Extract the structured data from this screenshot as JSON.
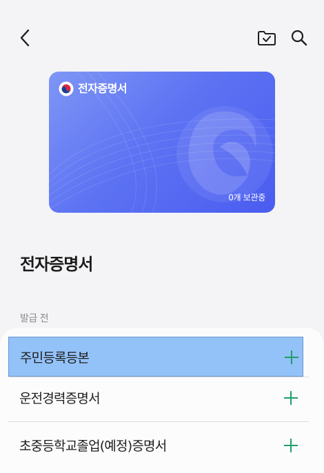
{
  "header": {
    "back_icon": "chevron-left-icon",
    "folder_icon": "folder-check-icon",
    "search_icon": "search-icon"
  },
  "card": {
    "title": "전자증명서",
    "count": "0개 보관중",
    "emblem_icon": "taegeuk-emblem-icon",
    "colors": {
      "start": "#7f96f5",
      "end": "#4a5cf0"
    }
  },
  "page": {
    "title": "전자증명서",
    "section_label": "발급 전"
  },
  "items": [
    {
      "label": "주민등록등본"
    },
    {
      "label": "운전경력증명서"
    },
    {
      "label": "초중등학교졸업(예정)증명서"
    }
  ],
  "colors": {
    "accent_plus": "#1f9d6a",
    "selected_row": "#93c2f8"
  }
}
